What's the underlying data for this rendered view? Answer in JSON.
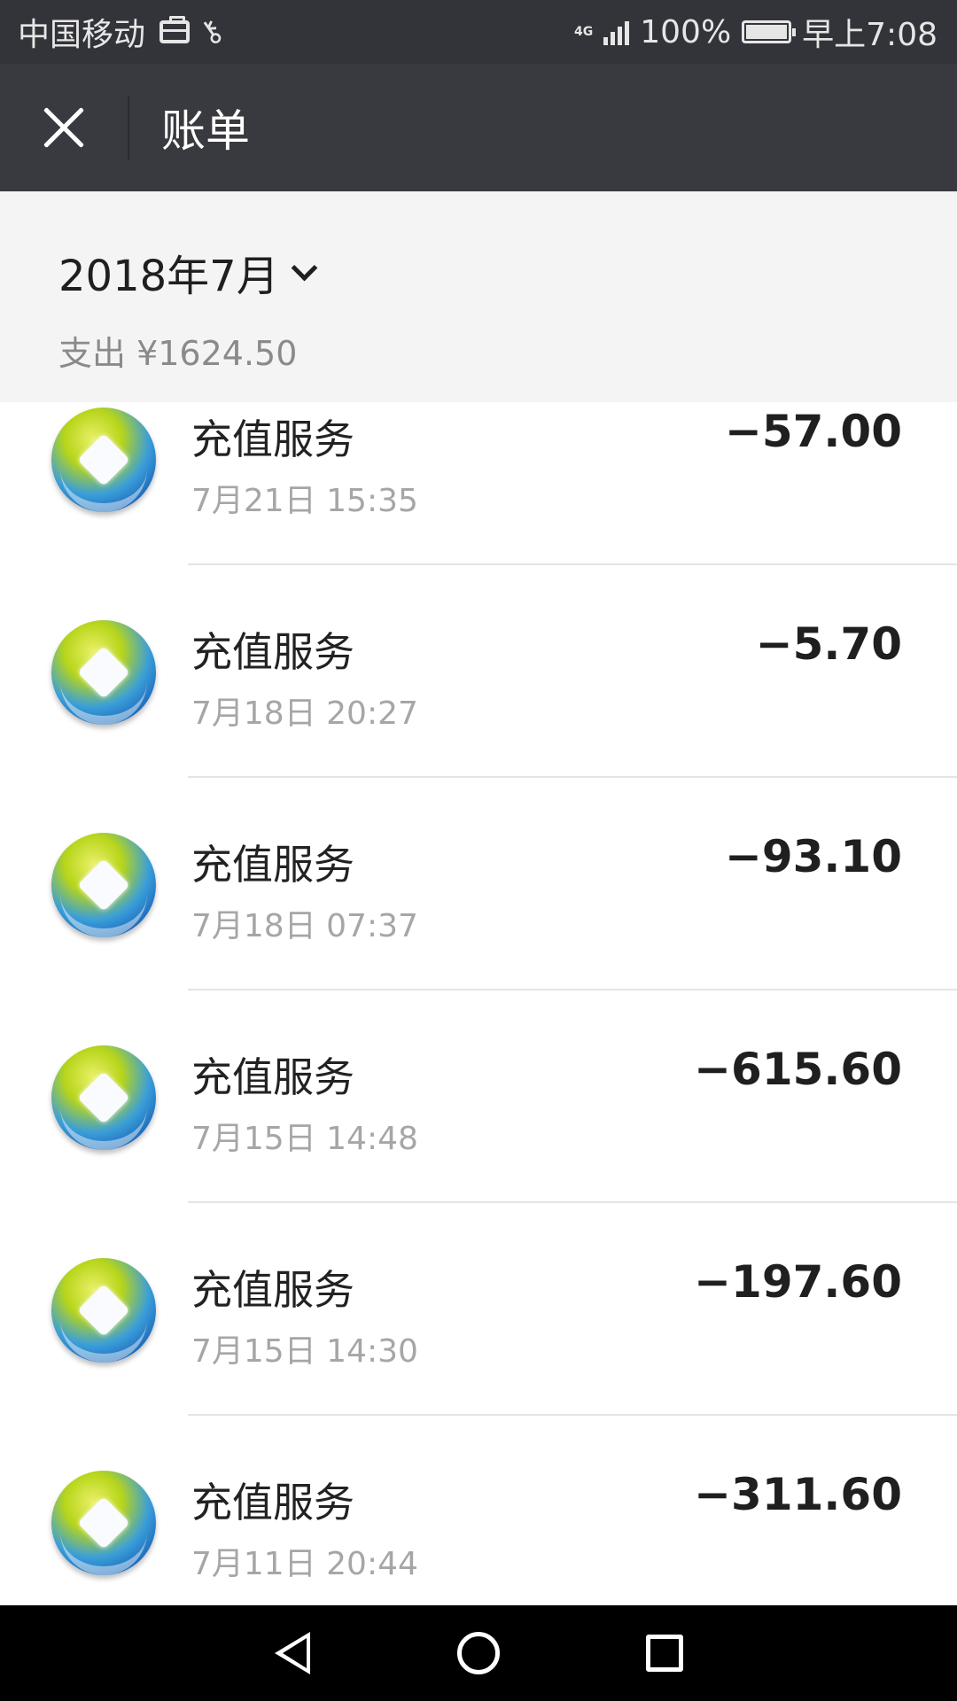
{
  "status_bar": {
    "carrier": "中国移动",
    "network": "4G",
    "battery": "100%",
    "battery_level": 1.0,
    "time": "早上7:08"
  },
  "header": {
    "title": "账单"
  },
  "month": {
    "label": "2018年7月",
    "summary": "支出 ¥1624.50"
  },
  "bills": [
    {
      "title": "充值服务",
      "time": "7月21日 15:35",
      "amount": "−57.00"
    },
    {
      "title": "充值服务",
      "time": "7月18日 20:27",
      "amount": "−5.70"
    },
    {
      "title": "充值服务",
      "time": "7月18日 07:37",
      "amount": "−93.10"
    },
    {
      "title": "充值服务",
      "time": "7月15日 14:48",
      "amount": "−615.60"
    },
    {
      "title": "充值服务",
      "time": "7月15日 14:30",
      "amount": "−197.60"
    },
    {
      "title": "充值服务",
      "time": "7月11日 20:44",
      "amount": "−311.60"
    }
  ],
  "icons": {
    "close": "close-icon",
    "dropdown": "chevron-down-icon",
    "bill": "recharge-service-icon",
    "nav": [
      "back-icon",
      "home-icon",
      "recents-icon"
    ]
  },
  "colors": {
    "status_bar": "#333439",
    "title_bar": "#393a3f",
    "month_header": "#f4f4f4",
    "nav_bar": "#000000"
  }
}
